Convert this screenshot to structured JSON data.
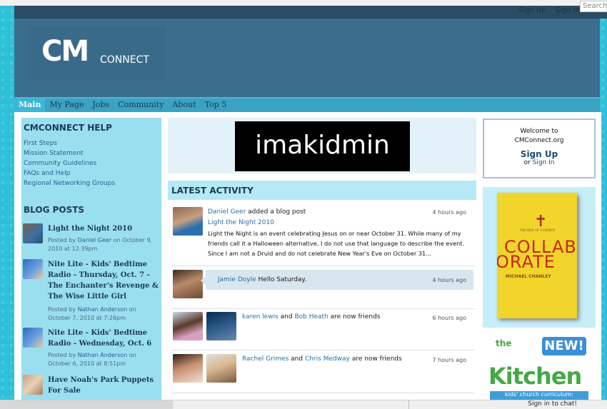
{
  "topbar": {
    "sign_up": "Sign Up",
    "sign_in": "Sign In",
    "search_placeholder": "Search"
  },
  "logo": {
    "cm": "CM",
    "connect": "CONNECT"
  },
  "nav": [
    "Main",
    "My Page",
    "Jobs",
    "Community",
    "About",
    "Top 5"
  ],
  "help": {
    "title": "CMCONNECT HELP",
    "links": [
      "First Steps",
      "Mission Statement",
      "Community Guidelines",
      "FAQs and Help",
      "Regional Networking Groups"
    ]
  },
  "blog": {
    "title": "BLOG POSTS",
    "posts": [
      {
        "title": "Light the Night 2010",
        "posted_by": "Posted by",
        "author": "Daniel Geer",
        "on": "on October 9, 2010 at 12:39pm"
      },
      {
        "title": "Nite Lite - Kids' Bedtime Radio - Thursday, Oct. 7 - The Enchanter's Revenge & The Wise Little Girl",
        "posted_by": "Posted by",
        "author": "Nathan Anderson",
        "on": "on October 7, 2010 at 7:26pm"
      },
      {
        "title": "Nite Lite - Kids' Bedtime Radio - Wednesday, Oct. 6",
        "posted_by": "Posted by",
        "author": "Nathan Anderson",
        "on": "on October 6, 2010 at 8:51pm"
      },
      {
        "title": "Have Noah's Park Puppets For Sale"
      }
    ]
  },
  "banner": {
    "text": "imakidmin"
  },
  "latest": {
    "title": "LATEST ACTIVITY",
    "items": [
      {
        "actor": "Daniel Geer",
        "action": "added a blog post",
        "time": "4 hours ago",
        "link": "Light the Night 2010",
        "body": "Light the Night is an event celebrating Jesus on or near October 31. While many of my friends call it a Halloween alternative, I do not use that language to describe the event. Since I am not a Druid and do not celebrate New Year's Eve on October 31..."
      },
      {
        "actor": "Jamie Doyle",
        "action": "Hello Saturday.",
        "time": "4 hours ago"
      },
      {
        "actor": "karen lewis",
        "and": "and",
        "actor2": "Bob Heath",
        "action": "are now friends",
        "time": "6 hours ago"
      },
      {
        "actor": "Rachel Grimes",
        "and": "and",
        "actor2": "Chris Medway",
        "action": "are now friends",
        "time": "7 hours ago"
      }
    ]
  },
  "welcome": {
    "line1": "Welcome to",
    "line2": "CMConnect.org",
    "sign_up": "Sign Up",
    "or": "or",
    "sign_in": "Sign In"
  },
  "book_ad": {
    "small": "THE SOUL OF A CHURCH",
    "line1": "COLLABC",
    "line2": "ORATE",
    "author": "MICHAEL CHANLEY"
  },
  "kitchen_ad": {
    "new": "NEW!",
    "the": "the",
    "kitchen": "Kitchen",
    "sub": "kids' church curriculum:"
  },
  "bottombar": {
    "chat": "Sign in to chat!"
  },
  "colors": {
    "accent": "#2fc0d8",
    "header": "#3c6d8f",
    "nav": "#3aa2c2",
    "sidebar": "#99dff0"
  }
}
